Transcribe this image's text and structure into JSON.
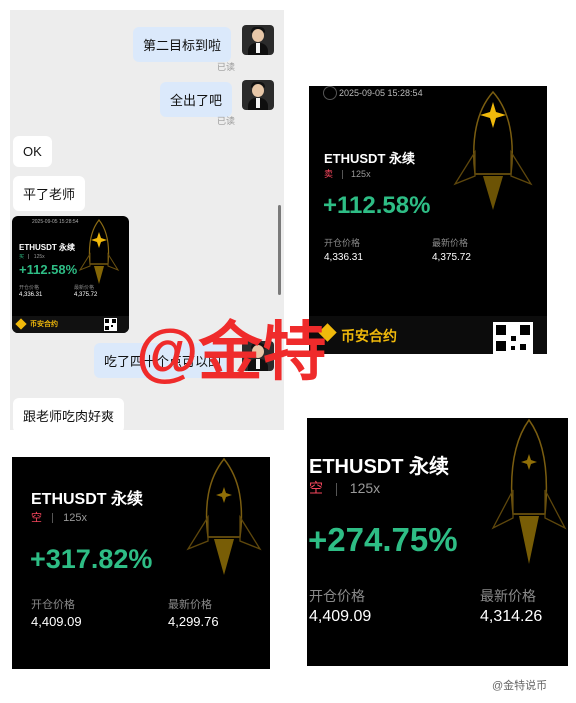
{
  "chat": {
    "messages": [
      {
        "side": "right",
        "text": "第二目标到啦",
        "status": "已读"
      },
      {
        "side": "right",
        "text": "全出了吧",
        "status": "已读"
      },
      {
        "side": "left",
        "text": "OK"
      },
      {
        "side": "left",
        "text": "平了老师"
      },
      {
        "side": "right",
        "text": "吃了四十个点可以的"
      },
      {
        "side": "left",
        "text": "跟老师吃肉好爽"
      }
    ],
    "thumb": {
      "timestamp": "2025-09-05 15:28:54",
      "pair": "ETHUSDT 永续",
      "side": "买",
      "leverage": "125x",
      "pnl": "+112.58%",
      "open_label": "开仓价格",
      "open_value": "4,336.31",
      "last_label": "最新价格",
      "last_value": "4,375.72",
      "brand": "币安合约"
    }
  },
  "card1": {
    "timestamp": "2025-09-05 15:28:54",
    "pair": "ETHUSDT 永续",
    "side": "卖",
    "leverage": "125x",
    "pnl": "+112.58%",
    "open_label": "开仓价格",
    "open_value": "4,336.31",
    "last_label": "最新价格",
    "last_value": "4,375.72",
    "brand": "币安合约"
  },
  "card2": {
    "pair": "ETHUSDT 永续",
    "side": "空",
    "leverage": "125x",
    "pnl": "+317.82%",
    "open_label": "开仓价格",
    "open_value": "4,409.09",
    "last_label": "最新价格",
    "last_value": "4,299.76"
  },
  "card3": {
    "pair": "ETHUSDT 永续",
    "side": "空",
    "leverage": "125x",
    "pnl": "+274.75%",
    "open_label": "开仓价格",
    "open_value": "4,409.09",
    "last_label": "最新价格",
    "last_value": "4,314.26"
  },
  "watermark": "@金特",
  "footer": "@金特说币",
  "colors": {
    "profit": "#2ebd85",
    "short": "#f6465d",
    "watermark": "#ef2b2b",
    "brand": "#f0b90b",
    "bubble_self": "#dbe9fb"
  }
}
